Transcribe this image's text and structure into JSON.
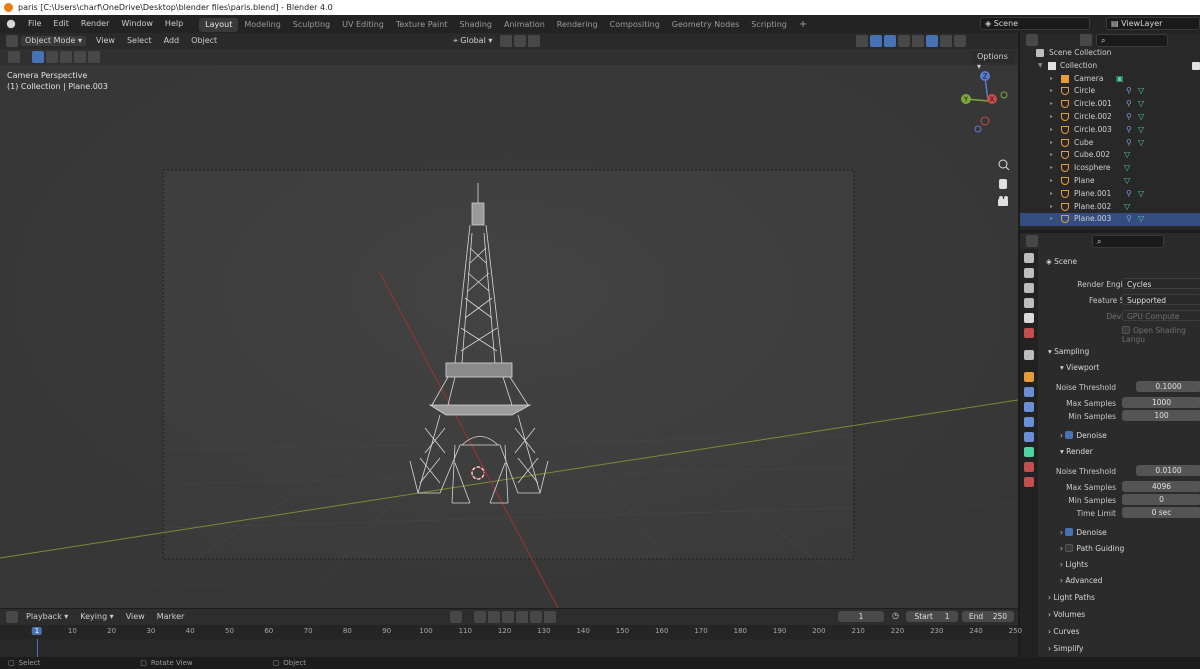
{
  "title_bar": {
    "title": "paris [C:\\Users\\charf\\OneDrive\\Desktop\\blender files\\paris.blend] - Blender 4.0"
  },
  "menu": [
    "File",
    "Edit",
    "Render",
    "Window",
    "Help"
  ],
  "workspaces": [
    "Layout",
    "Modeling",
    "Sculpting",
    "UV Editing",
    "Texture Paint",
    "Shading",
    "Animation",
    "Rendering",
    "Compositing",
    "Geometry Nodes",
    "Scripting"
  ],
  "active_workspace": "Layout",
  "scene_name": "Scene",
  "view_layer": "ViewLayer",
  "viewport": {
    "mode": "Object Mode",
    "menus": [
      "View",
      "Select",
      "Add",
      "Object"
    ],
    "transform_orientation": "Global",
    "options_label": "Options",
    "overlay_line1": "Camera Perspective",
    "overlay_line2": "(1) Collection | Plane.003",
    "gizmo_labels": {
      "x": "X",
      "y": "Y",
      "z": "Z"
    }
  },
  "outliner": {
    "root": "Scene Collection",
    "collection": "Collection",
    "items": [
      {
        "name": "Camera",
        "icon": "camera-icon",
        "mod": false
      },
      {
        "name": "Circle",
        "icon": "mesh-icon",
        "mod": true
      },
      {
        "name": "Circle.001",
        "icon": "mesh-icon",
        "mod": true
      },
      {
        "name": "Circle.002",
        "icon": "mesh-icon",
        "mod": true
      },
      {
        "name": "Circle.003",
        "icon": "mesh-icon",
        "mod": true
      },
      {
        "name": "Cube",
        "icon": "mesh-icon",
        "mod": true
      },
      {
        "name": "Cube.002",
        "icon": "mesh-icon",
        "mod": false
      },
      {
        "name": "Icosphere",
        "icon": "mesh-icon",
        "mod": false
      },
      {
        "name": "Plane",
        "icon": "mesh-icon",
        "mod": false
      },
      {
        "name": "Plane.001",
        "icon": "mesh-icon",
        "mod": true
      },
      {
        "name": "Plane.002",
        "icon": "mesh-icon",
        "mod": false
      },
      {
        "name": "Plane.003",
        "icon": "mesh-icon",
        "mod": true
      }
    ]
  },
  "properties": {
    "context": "Scene",
    "render_engine_label": "Render Engine",
    "render_engine": "Cycles",
    "feature_set_label": "Feature Set",
    "feature_set": "Supported",
    "device_label": "Device",
    "device": "GPU Compute",
    "osl_label": "Open Shading Langu",
    "sampling": "Sampling",
    "viewport_sub": "Viewport",
    "noise_threshold_label": "Noise Threshold",
    "vp_noise_threshold": "0.1000",
    "max_samples_label": "Max Samples",
    "vp_max_samples": "1000",
    "min_samples_label": "Min Samples",
    "vp_min_samples": "100",
    "denoise_label": "Denoise",
    "render_sub": "Render",
    "r_noise_threshold": "0.0100",
    "r_max_samples": "4096",
    "r_min_samples": "0",
    "time_limit_label": "Time Limit",
    "r_time_limit": "0 sec",
    "path_guiding": "Path Guiding",
    "lights": "Lights",
    "advanced": "Advanced",
    "light_paths": "Light Paths",
    "volumes": "Volumes",
    "curves": "Curves",
    "simplify": "Simplify"
  },
  "timeline": {
    "menus": [
      "Playback",
      "Keying",
      "View",
      "Marker"
    ],
    "current_frame": "1",
    "start_label": "Start",
    "start": "1",
    "end_label": "End",
    "end": "250",
    "ticks": [
      "1",
      "10",
      "20",
      "30",
      "40",
      "50",
      "60",
      "70",
      "80",
      "90",
      "100",
      "110",
      "120",
      "130",
      "140",
      "150",
      "160",
      "170",
      "180",
      "190",
      "200",
      "210",
      "220",
      "230",
      "240",
      "250"
    ]
  },
  "status": {
    "select": "Select",
    "rotate": "Rotate View",
    "object": "Object"
  }
}
